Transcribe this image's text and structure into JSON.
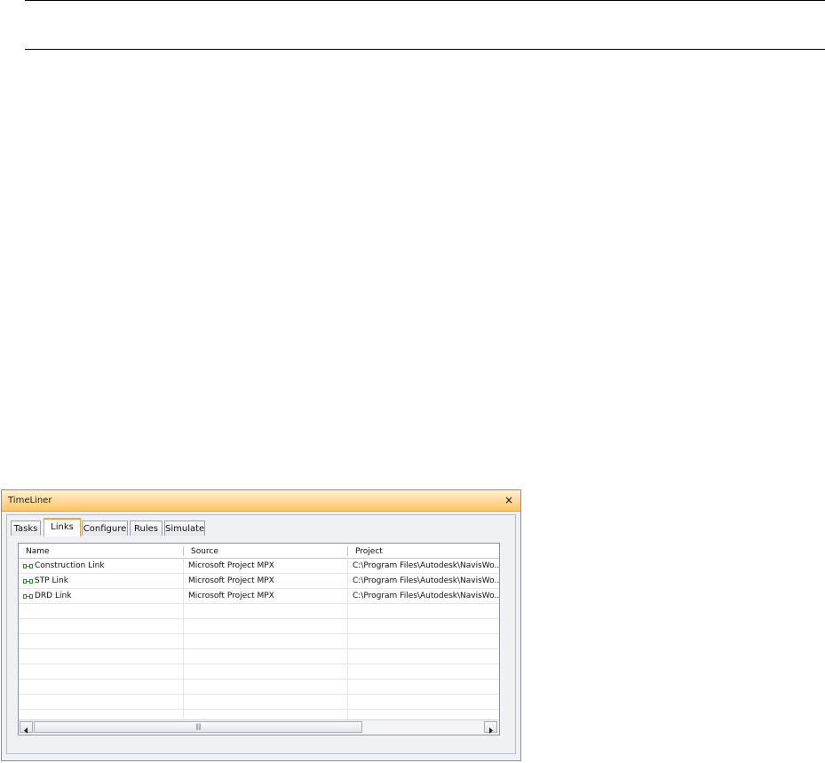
{
  "window": {
    "title": "TimeLiner",
    "close_glyph": "×"
  },
  "tabs": [
    {
      "label": "Tasks",
      "active": false
    },
    {
      "label": "Links",
      "active": true
    },
    {
      "label": "Configure",
      "active": false
    },
    {
      "label": "Rules",
      "active": false
    },
    {
      "label": "Simulate",
      "active": false
    }
  ],
  "grid": {
    "columns": [
      "Name",
      "Source",
      "Project"
    ],
    "rows": [
      {
        "name": "Construction Link",
        "source": "Microsoft Project MPX",
        "project": "C:\\Program Files\\Autodesk\\NavisWo..."
      },
      {
        "name": "STP Link",
        "source": "Microsoft Project MPX",
        "project": "C:\\Program Files\\Autodesk\\NavisWo..."
      },
      {
        "name": "DRD Link",
        "source": "Microsoft Project MPX",
        "project": "C:\\Program Files\\Autodesk\\NavisWo..."
      }
    ],
    "row_icon": "link-icon",
    "row_icon_color": "#2a8f2a"
  },
  "scrollbar": {
    "left_arrow": "◀",
    "right_arrow": "▶",
    "grip": "||||"
  },
  "colors": {
    "titlebar_accent": "#ffc55f",
    "active_tab_accent": "#f0a830"
  }
}
